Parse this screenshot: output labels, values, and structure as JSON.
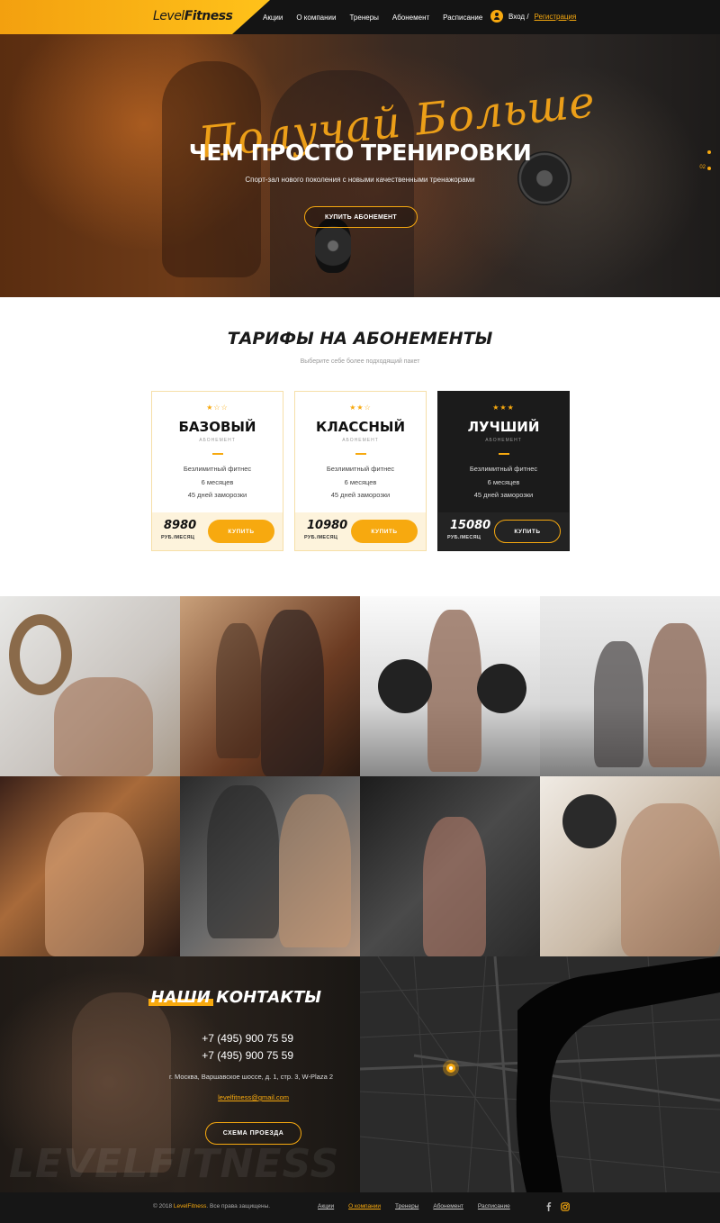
{
  "header": {
    "logo_a": "Level",
    "logo_b": "Fitness",
    "nav": [
      "Акции",
      "О компании",
      "Тренеры",
      "Абонемент",
      "Расписание"
    ],
    "login": "Вход /",
    "register": "Регистрация"
  },
  "hero": {
    "script": "Получай Больше",
    "title": "ЧЕМ ПРОСТО ТРЕНИРОВКИ",
    "subtitle": "Спорт-зал нового поколения с новыми качественными тренажорами",
    "button": "КУПИТЬ АБОНЕМЕНТ",
    "slide_num": "02"
  },
  "tariffs": {
    "title_hl": "ТАРИФЫ НА",
    "title_rest": " АБОНЕМЕНТЫ",
    "subtitle": "Выберите себе более подходящий пакет",
    "cards": [
      {
        "stars": "★☆☆",
        "name": "БАЗОВЫЙ",
        "sub": "АБОНЕМЕНТ",
        "f1": "Безлимитный фитнес",
        "f2": "6 месяцев",
        "f3": "45 дней заморозки",
        "price": "8980",
        "per": "РУБ./МЕСЯЦ",
        "buy": "КУПИТЬ"
      },
      {
        "stars": "★★☆",
        "name": "КЛАССНЫЙ",
        "sub": "АБОНЕМЕНТ",
        "f1": "Безлимитный фитнес",
        "f2": "6 месяцев",
        "f3": "45 дней заморозки",
        "price": "10980",
        "per": "РУБ./МЕСЯЦ",
        "buy": "КУПИТЬ"
      },
      {
        "stars": "★★★",
        "name": "ЛУЧШИЙ",
        "sub": "АБОНЕМЕНТ",
        "f1": "Безлимитный фитнес",
        "f2": "6 месяцев",
        "f3": "45 дней заморозки",
        "price": "15080",
        "per": "РУБ./МЕСЯЦ",
        "buy": "КУПИТЬ"
      }
    ]
  },
  "contacts": {
    "title_hl": "НАШИ",
    "title_rest": " КОНТАКТЫ",
    "phone1": "+7 (495) 900 75 59",
    "phone2": "+7 (495) 900 75 59",
    "address": "г. Москва, Варшавское шоссе, д. 1, стр. 3, W-Plaza 2",
    "email": "levelfitness@gmail.com",
    "route": "СХЕМА ПРОЕЗДА",
    "watermark": "LEVELFITNESS"
  },
  "footer": {
    "copy_a": "© 2018",
    "copy_brand": "LevelFitness",
    "copy_b": ". Все права защищены.",
    "nav": [
      "Акции",
      "О компании",
      "Тренеры",
      "Абонемент",
      "Расписание"
    ]
  },
  "colors": {
    "accent": "#f7a90f",
    "dark": "#161616"
  }
}
